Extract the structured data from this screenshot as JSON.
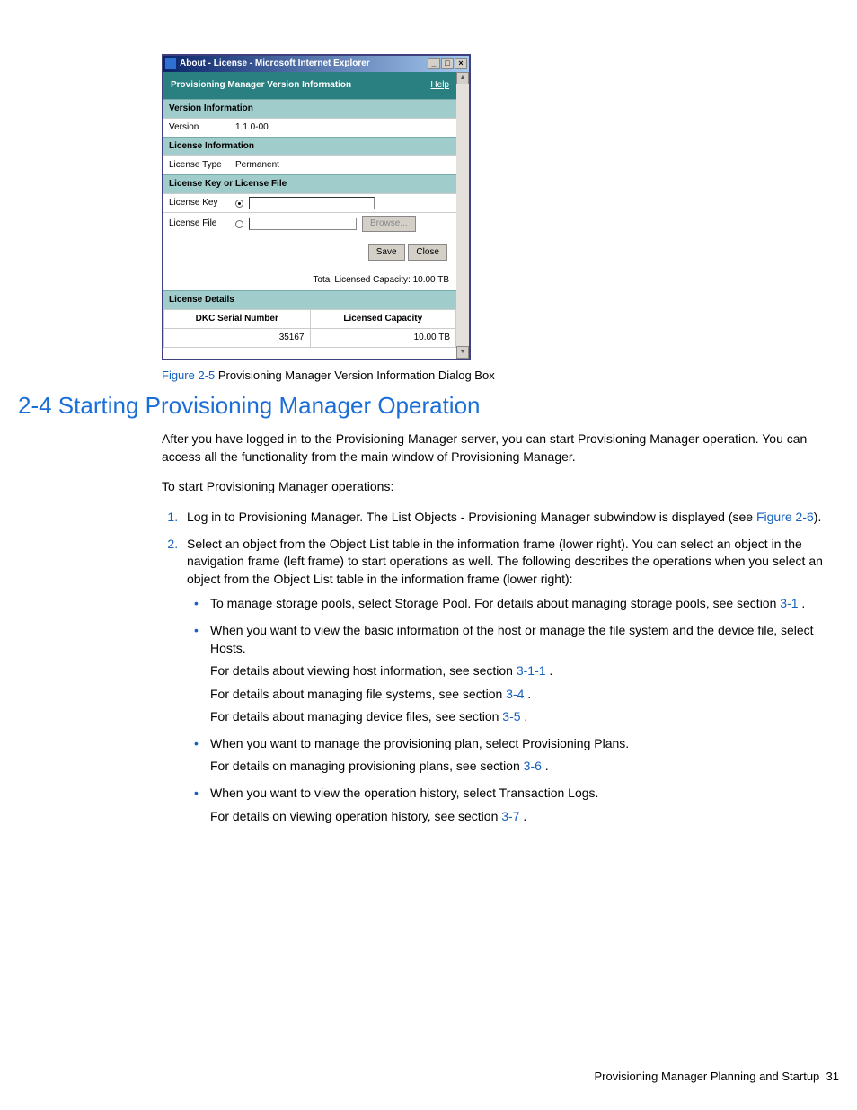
{
  "dialog": {
    "window_title": "About - License - Microsoft Internet Explorer",
    "min_btn": "_",
    "max_btn": "□",
    "close_btn": "×",
    "header_title": "Provisioning Manager Version Information",
    "help": "Help",
    "sec_version": "Version Information",
    "row_version_lbl": "Version",
    "row_version_val": "1.1.0-00",
    "sec_license": "License Information",
    "row_lictype_lbl": "License Type",
    "row_lictype_val": "Permanent",
    "sec_keyfile": "License Key or License File",
    "row_key_lbl": "License Key",
    "row_file_lbl": "License File",
    "browse_btn": "Browse...",
    "save_btn": "Save",
    "close_dlg_btn": "Close",
    "total_capacity": "Total Licensed Capacity: 10.00 TB",
    "sec_details": "License Details",
    "th_serial": "DKC Serial Number",
    "th_cap": "Licensed Capacity",
    "td_serial": "35167",
    "td_cap": "10.00 TB",
    "scroll_up": "▲",
    "scroll_down": "▼"
  },
  "figure": {
    "label": "Figure 2-5 ",
    "caption": "Provisioning Manager Version Information Dialog Box"
  },
  "heading": "2-4 Starting Provisioning Manager Operation",
  "paras": {
    "intro": "After you have logged in to the Provisioning Manager server, you can start Provisioning Manager operation. You can access all the functionality from the main window of Provisioning Manager.",
    "lead": "To start Provisioning Manager operations:",
    "s1a": "Log in to Provisioning Manager. The List Objects - Provisioning Manager subwindow is displayed (see ",
    "s1link": "Figure 2-6",
    "s1b": ").",
    "s2": "Select an object from the Object List table in the information frame (lower right). You can select an object in the navigation frame (left frame) to start operations as well. The following describes the operations when you select an object from the Object List table in the information frame (lower right):",
    "b1a": "To manage storage pools, select Storage Pool. For details about managing storage pools, see section ",
    "b1link": "3-1",
    "period_space": " .",
    "b2a": "When you want to view the basic information of the host or manage the file system and the device file, select Hosts.",
    "b2p1a": "For details about viewing host information, see section ",
    "b2p1link": "3-1-1",
    "b2p2a": "For details about managing file systems, see section ",
    "b2p2link": "3-4",
    "b2p3a": "For details about managing device files, see section ",
    "b2p3link": "3-5",
    "b3a": "When you want to manage the provisioning plan, select Provisioning Plans.",
    "b3p1a": "For details on managing provisioning plans, see section ",
    "b3p1link": "3-6",
    "b4a": "When you want to view the operation history, select Transaction Logs.",
    "b4p1a": "For details on viewing operation history, see section ",
    "b4p1link": "3-7"
  },
  "footer": {
    "text": "Provisioning Manager Planning and Startup",
    "page": "31"
  }
}
